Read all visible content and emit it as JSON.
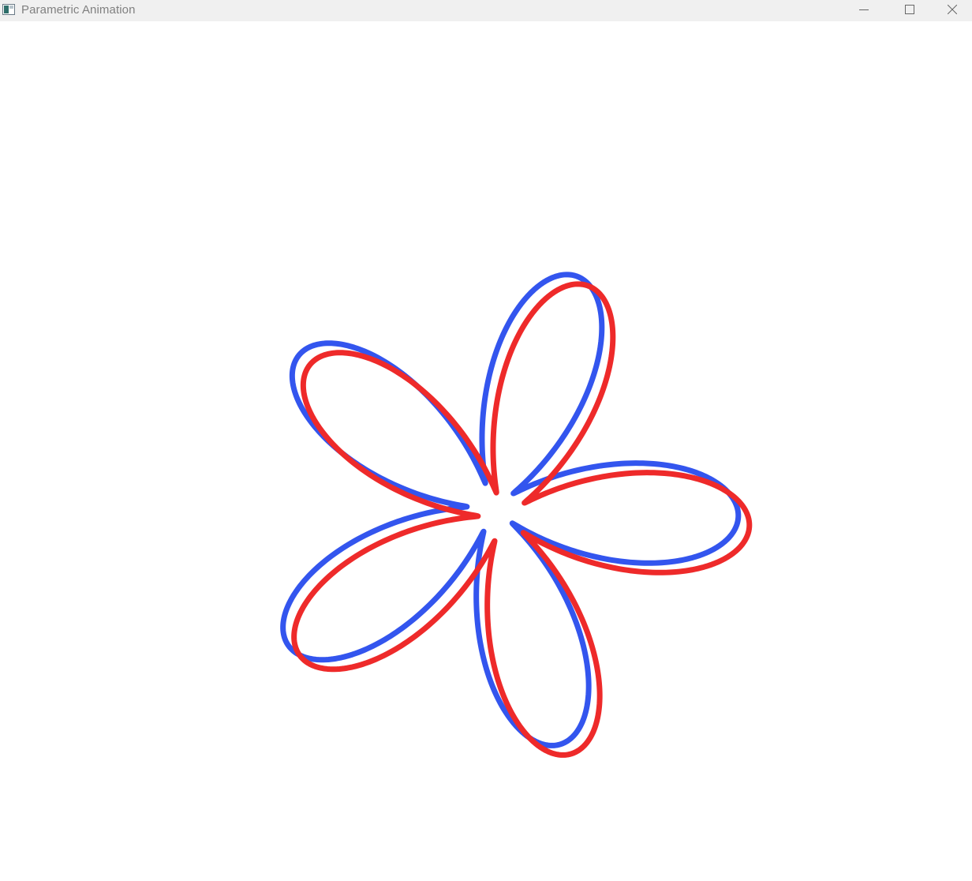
{
  "window": {
    "title": "Parametric Animation",
    "icons": {
      "app": "app-window-icon",
      "minimize": "minimize-icon",
      "maximize": "maximize-icon",
      "close": "close-icon"
    }
  },
  "curves": [
    {
      "name": "blue-curve",
      "color": "#3355ee"
    },
    {
      "name": "red-curve",
      "color": "#ee2a2a"
    }
  ],
  "colors": {
    "titlebar": "#f0f0f0",
    "title_text": "#808080",
    "canvas": "#ffffff"
  }
}
